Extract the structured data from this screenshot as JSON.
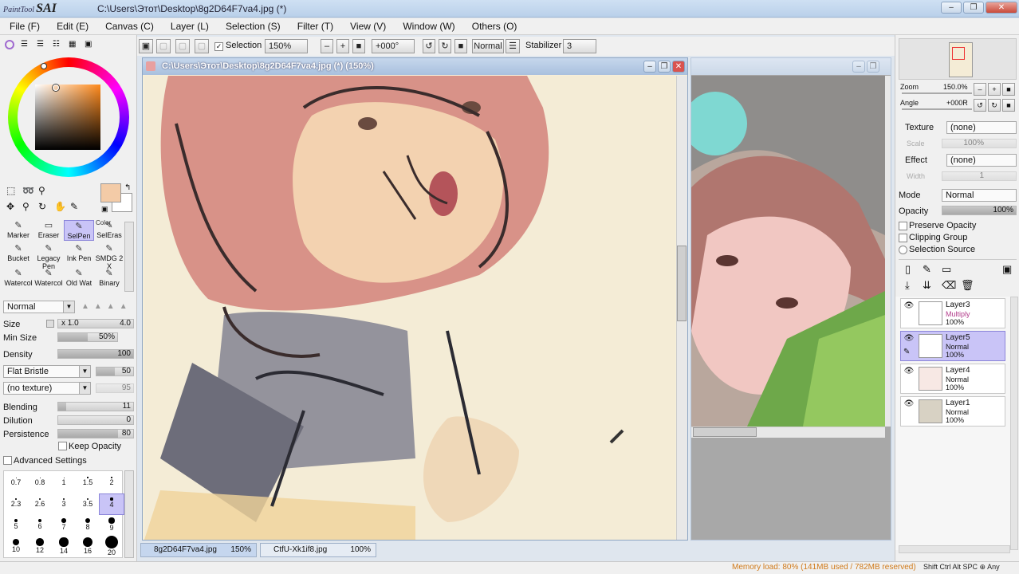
{
  "app": {
    "logo": "SAI",
    "logo_prefix": "PaintTool",
    "window_title": "C:\\Users\\Этот\\Desktop\\8g2D64F7va4.jpg (*)",
    "win_buttons": [
      "–",
      "❐",
      "✕"
    ]
  },
  "menu": [
    "File (F)",
    "Edit (E)",
    "Canvas (C)",
    "Layer (L)",
    "Selection (S)",
    "Filter (T)",
    "View (V)",
    "Window (W)",
    "Others (O)"
  ],
  "toolbar": {
    "selection_label": "Selection",
    "zoom_value": "150%",
    "angle_value": "+000°",
    "blend_mode": "Normal",
    "stabilizer_label": "Stabilizer",
    "stabilizer_value": "3"
  },
  "tools": [
    {
      "label": "Marker",
      "icon": "marker-icon"
    },
    {
      "label": "Eraser",
      "icon": "eraser-icon"
    },
    {
      "label": "SelPen",
      "icon": "selpen-icon"
    },
    {
      "label": "SelEras",
      "icon": "seleras-icon"
    },
    {
      "label": "Bucket",
      "icon": "bucket-icon"
    },
    {
      "label": "Legacy Pen",
      "icon": "legacy-pen-icon"
    },
    {
      "label": "Ink Pen",
      "icon": "ink-pen-icon"
    },
    {
      "label": "SMDG 2 X",
      "icon": "smdg-icon"
    },
    {
      "label": "Watercol",
      "icon": "watercolor-icon"
    },
    {
      "label": "Watercol",
      "icon": "watercolor-icon"
    },
    {
      "label": "Old Wat",
      "icon": "old-water-icon"
    },
    {
      "label": "Binary",
      "icon": "binary-icon"
    }
  ],
  "color_tool_label": "Color",
  "brush": {
    "mode": "Normal",
    "size_label": "Size",
    "size_mult": "x 1.0",
    "size_value": "4.0",
    "min_size_label": "Min Size",
    "min_size_value": "50%",
    "min_size_fill": 50,
    "density_label": "Density",
    "density_value": "100",
    "bristle": "Flat Bristle",
    "bristle_value": "50",
    "texture": "(no texture)",
    "texture_value": "95",
    "blending_label": "Blending",
    "blending_value": "11",
    "dilution_label": "Dilution",
    "dilution_value": "0",
    "persistence_label": "Persistence",
    "persistence_value": "80",
    "keep_opacity": "Keep Opacity",
    "advanced": "Advanced Settings"
  },
  "brush_sizes": [
    "0.7",
    "0.8",
    "1",
    "1.5",
    "2",
    "2.3",
    "2.6",
    "3",
    "3.5",
    "4",
    "5",
    "6",
    "7",
    "8",
    "9",
    "10",
    "12",
    "14",
    "16",
    "20"
  ],
  "canvas": {
    "title": "C:\\Users\\Этот\\Desktop\\8g2D64F7va4.jpg (*) (150%)"
  },
  "navigator": {
    "zoom_label": "Zoom",
    "zoom_value": "150.0%",
    "angle_label": "Angle",
    "angle_value": "+000R"
  },
  "layer_props": {
    "texture_label": "Texture",
    "texture_value": "(none)",
    "scale_label": "Scale",
    "scale_value": "100%",
    "effect_label": "Effect",
    "effect_value": "(none)",
    "width_label": "Width",
    "width_value": "1",
    "mode_label": "Mode",
    "mode_value": "Normal",
    "opacity_label": "Opacity",
    "opacity_value": "100%",
    "preserve_opacity": "Preserve Opacity",
    "clipping_group": "Clipping Group",
    "selection_source": "Selection Source"
  },
  "layers": [
    {
      "name": "Layer3",
      "mode": "Multiply",
      "opacity": "100%"
    },
    {
      "name": "Layer5",
      "mode": "Normal",
      "opacity": "100%"
    },
    {
      "name": "Layer4",
      "mode": "Normal",
      "opacity": "100%"
    },
    {
      "name": "Layer1",
      "mode": "Normal",
      "opacity": "100%"
    }
  ],
  "tabs": [
    {
      "name": "8g2D64F7va4.jpg",
      "zoom": "150%"
    },
    {
      "name": "CtfU-Xk1if8.jpg",
      "zoom": "100%"
    }
  ],
  "status": {
    "memory": "Memory load: 80% (141MB used / 782MB reserved)",
    "keys": "Shift Ctrl Alt SPC ⊕ Any"
  },
  "colors": {
    "current_color": "#f3cba7",
    "accent": "#c9c4f7"
  }
}
